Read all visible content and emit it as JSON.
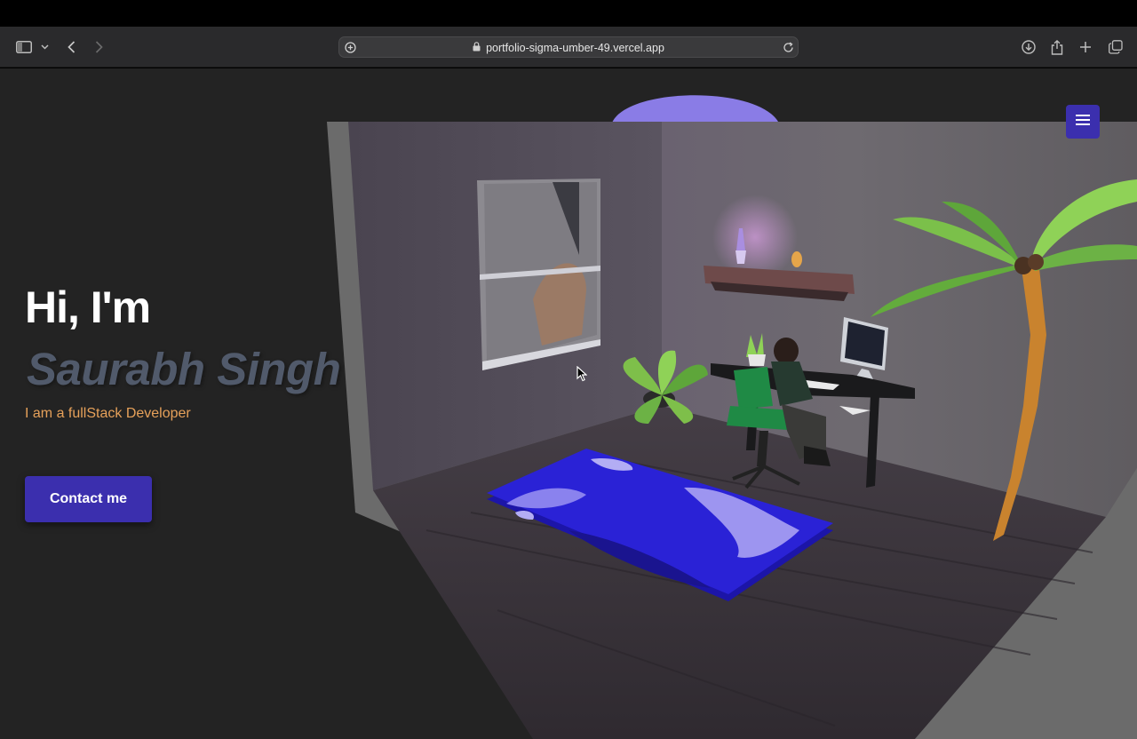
{
  "browser": {
    "url": "portfolio-sigma-umber-49.vercel.app",
    "icons": [
      "sidebar-icon",
      "chevron-down-icon",
      "back-icon",
      "forward-icon",
      "site-settings-icon",
      "lock-icon",
      "reload-icon",
      "download-icon",
      "share-icon",
      "new-tab-icon",
      "tab-overview-icon"
    ]
  },
  "hero": {
    "greeting": "Hi, I'm",
    "name": "Saurabh Singh",
    "subtitle": "I am a fullStack Developer",
    "contact_label": "Contact me"
  },
  "nav": {
    "menu_icon": "hamburger-icon"
  },
  "colors": {
    "accent": "#3b2fae",
    "page_bg": "#232323",
    "subtitle": "#e6a15a",
    "name": "#515a6b",
    "rug": "#2a22d6"
  }
}
